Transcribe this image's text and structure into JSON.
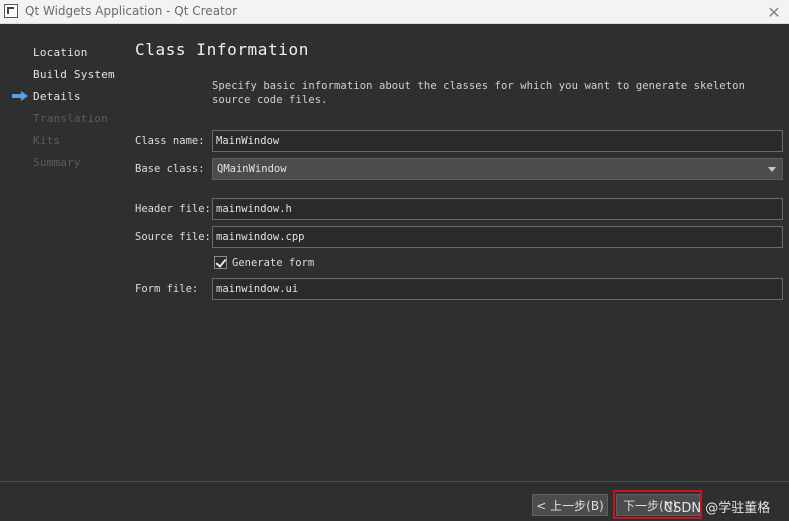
{
  "window": {
    "title": "Qt Widgets Application - Qt Creator",
    "close_glyph": "✕"
  },
  "sidebar": {
    "items": [
      {
        "label": "Location",
        "state": "done"
      },
      {
        "label": "Build System",
        "state": "done"
      },
      {
        "label": "Details",
        "state": "current"
      },
      {
        "label": "Translation",
        "state": "disabled"
      },
      {
        "label": "Kits",
        "state": "disabled"
      },
      {
        "label": "Summary",
        "state": "disabled"
      }
    ]
  },
  "page": {
    "title": "Class Information",
    "description": "Specify basic information about the classes for which you want to generate skeleton source code files."
  },
  "form": {
    "class_name_label": "Class name:",
    "class_name_value": "MainWindow",
    "base_class_label": "Base class:",
    "base_class_value": "QMainWindow",
    "header_file_label": "Header file:",
    "header_file_value": "mainwindow.h",
    "source_file_label": "Source file:",
    "source_file_value": "mainwindow.cpp",
    "generate_form_label": "Generate form",
    "generate_form_checked": true,
    "form_file_label": "Form file:",
    "form_file_value": "mainwindow.ui"
  },
  "footer": {
    "back_label": "< 上一步(B)",
    "next_label": "下一步(N)",
    "watermark": "CSDN @学驻董格"
  },
  "colors": {
    "background": "#2e2f30",
    "highlight_box": "#d0101a",
    "current_arrow": "#5aa0e6"
  }
}
